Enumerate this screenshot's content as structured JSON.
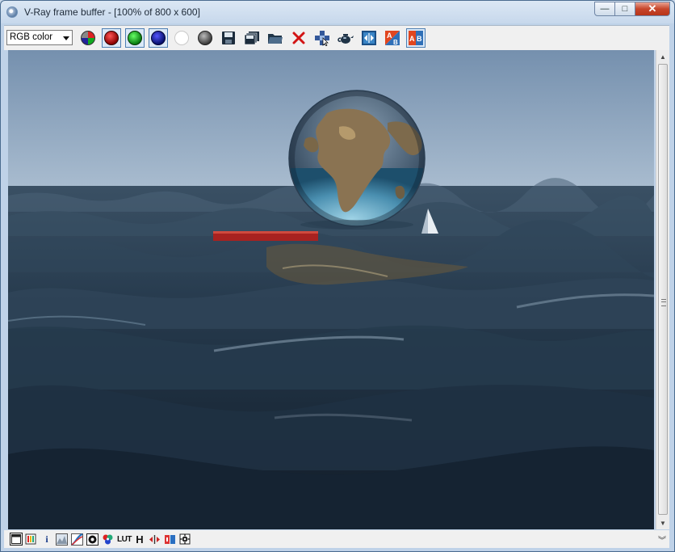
{
  "window": {
    "title": "V-Ray frame buffer - [100% of 800 x 600]",
    "controls": {
      "minimize": "—",
      "maximize": "□",
      "close": "✕"
    }
  },
  "toolbar": {
    "channel_select": {
      "value": "RGB color"
    },
    "items": [
      {
        "name": "track-mouse-icon"
      },
      {
        "name": "red-channel-icon",
        "color": "#b01010",
        "pressed": true
      },
      {
        "name": "green-channel-icon",
        "color": "#13a323",
        "pressed": true
      },
      {
        "name": "blue-channel-icon",
        "color": "#0d1a8c",
        "pressed": true
      },
      {
        "name": "alpha-channel-icon",
        "color": "#ffffff"
      },
      {
        "name": "monochrome-icon",
        "color": "#666666"
      },
      {
        "name": "save-image-icon"
      },
      {
        "name": "save-all-icon"
      },
      {
        "name": "load-image-icon"
      },
      {
        "name": "clear-image-icon",
        "color": "#d21414"
      },
      {
        "name": "follow-mouse-icon"
      },
      {
        "name": "render-last-icon"
      },
      {
        "name": "vfb-history-icon"
      },
      {
        "name": "compare-a-icon"
      },
      {
        "name": "compare-ab-icon"
      }
    ]
  },
  "statusbar": {
    "info_label": "i",
    "lut_label": "LUT",
    "h_label": "H"
  },
  "colors": {
    "sky_top": "#7590ae",
    "sky_horizon": "#a9bccf",
    "water_dark": "#0f1823",
    "water_mid": "#2c4257",
    "accent_red": "#a82220"
  }
}
